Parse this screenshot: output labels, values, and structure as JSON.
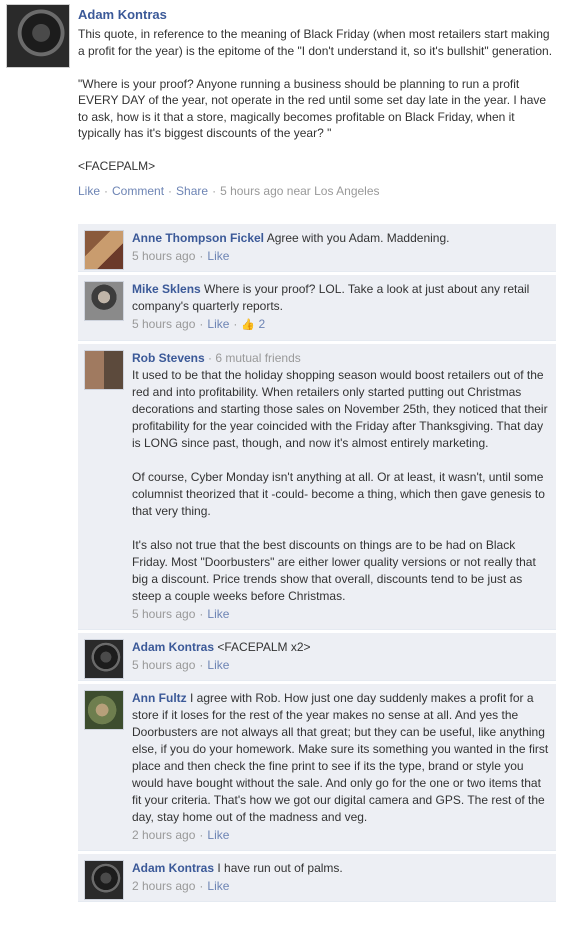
{
  "post": {
    "author": "Adam Kontras",
    "text": "This quote, in reference to the meaning of Black Friday (when most retailers start making a profit for the year) is the epitome of the \"I don't understand it, so it's bullshit\" generation.\n\n\"Where is your proof? Anyone running a business should be planning to run a profit EVERY DAY of the year, not operate in the red until some set day late in the year. I have to ask, how is it that a store, magically becomes profitable on Black Friday, when it typically has it's biggest discounts of the year? \"\n\n<FACEPALM>",
    "actions": {
      "like": "Like",
      "comment": "Comment",
      "share": "Share"
    },
    "time": "5 hours ago near Los Angeles"
  },
  "comments": [
    {
      "author": "Anne Thompson Fickel",
      "text": "Agree with you Adam. Maddening.",
      "time": "5 hours ago",
      "like": "Like"
    },
    {
      "author": "Mike Sklens",
      "text": "Where is your proof? LOL. Take a look at just about any retail company's quarterly reports.",
      "time": "5 hours ago",
      "like": "Like",
      "like_count": "2"
    },
    {
      "author": "Rob Stevens",
      "mutual": "· 6 mutual friends",
      "paragraphs": [
        "It used to be that the holiday shopping season would boost retailers out of the red and into profitability. When retailers only started putting out Christmas decorations and starting those sales on November 25th, they noticed that their profitability for the year coincided with the Friday after Thanksgiving. That day is LONG since past, though, and now it's almost entirely marketing.",
        "Of course, Cyber Monday isn't anything at all. Or at least, it wasn't, until some columnist theorized that it -could- become a thing, which then gave genesis to that very thing.",
        "It's also not true that the best discounts on things are to be had on Black Friday. Most \"Doorbusters\" are either lower quality versions or not really that big a discount. Price trends show that overall, discounts tend to be just as steep a couple weeks before Christmas."
      ],
      "time": "5 hours ago",
      "like": "Like"
    },
    {
      "author": "Adam Kontras",
      "text": "<FACEPALM x2>",
      "time": "5 hours ago",
      "like": "Like"
    },
    {
      "author": "Ann Fultz",
      "text": "I agree with Rob. How just one day suddenly makes a profit for a store if it loses for the rest of the year makes no sense at all. And yes the Doorbusters are not always all that great; but they can be useful, like anything else, if you do your homework. Make sure its something you wanted in the first place and then check the fine print to see if its the type, brand or style you would have bought without the sale. And only go for the one or two items that fit your criteria. That's how we got our digital camera and GPS. The rest of the day, stay home out of the madness and veg.",
      "time": "2 hours ago",
      "like": "Like"
    },
    {
      "author": "Adam Kontras",
      "text": "I have run out of palms.",
      "time": "2 hours ago",
      "like": "Like"
    }
  ]
}
